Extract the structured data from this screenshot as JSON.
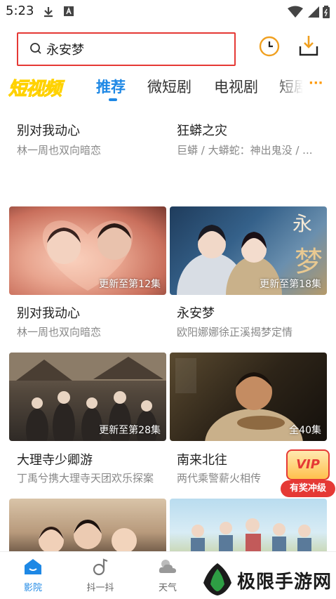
{
  "status_bar": {
    "time": "5:23"
  },
  "search": {
    "query": "永安梦"
  },
  "tabs": {
    "logo_text": "短视频",
    "items": [
      {
        "label": "推荐"
      },
      {
        "label": "微短剧"
      },
      {
        "label": "电视剧"
      },
      {
        "label": "短剧"
      }
    ],
    "more": "···"
  },
  "top_row": [
    {
      "title": "别对我动心",
      "subtitle": "林一周也双向暗恋"
    },
    {
      "title": "狂蟒之灾",
      "subtitle": "巨蟒 / 大蟒蛇：神出鬼没 / ..."
    }
  ],
  "cards": [
    {
      "title": "别对我动心",
      "subtitle": "林一周也双向暗恋",
      "badge": "更新至第12集"
    },
    {
      "title": "永安梦",
      "subtitle": "欧阳娜娜徐正溪揭梦定情",
      "badge": "更新至第18集"
    },
    {
      "title": "大理寺少卿游",
      "subtitle": "丁禹兮携大理寺天团欢乐探案",
      "badge": "更新至第28集"
    },
    {
      "title": "南来北往",
      "subtitle": "两代乘警薪火相传",
      "badge": "全40集"
    }
  ],
  "vip": {
    "top": "VIP",
    "label": "有奖冲级"
  },
  "bottom_nav": [
    {
      "label": "影院"
    },
    {
      "label": "抖一抖"
    },
    {
      "label": "天气"
    }
  ],
  "watermark": {
    "text": "极限手游网"
  },
  "colors": {
    "accent": "#1e88e5",
    "highlight_border": "#e53935",
    "vip": "#e53935"
  }
}
